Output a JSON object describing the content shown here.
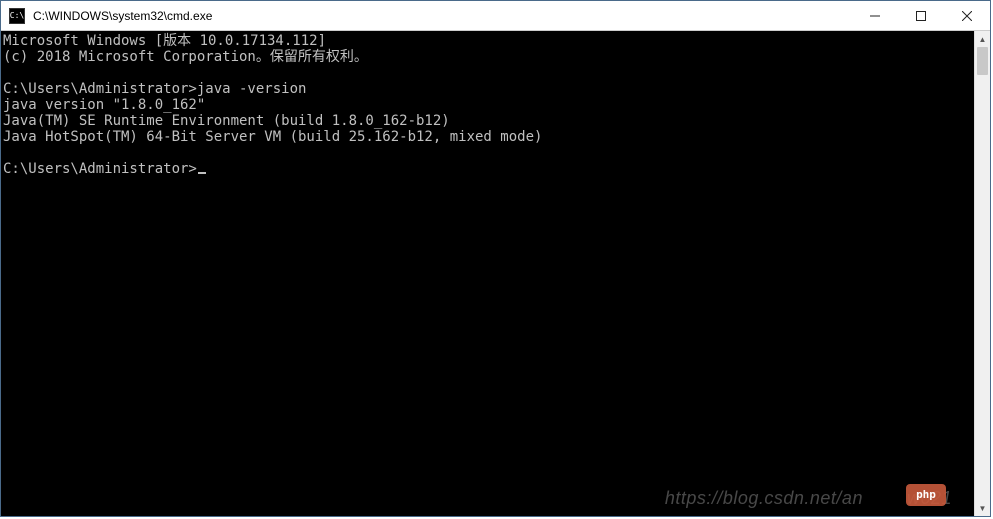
{
  "window": {
    "title": "C:\\WINDOWS\\system32\\cmd.exe",
    "icon_label": "C:\\"
  },
  "terminal": {
    "lines": [
      "Microsoft Windows [版本 10.0.17134.112]",
      "(c) 2018 Microsoft Corporation。保留所有权利。",
      "",
      "C:\\Users\\Administrator>java -version",
      "java version \"1.8.0_162\"",
      "Java(TM) SE Runtime Environment (build 1.8.0_162-b12)",
      "Java HotSpot(TM) 64-Bit Server VM (build 25.162-b12, mixed mode)",
      "",
      "C:\\Users\\Administrator>"
    ],
    "prompt": "C:\\Users\\Administrator>",
    "last_command": "java -version"
  },
  "watermark": {
    "text": "https://blog.csdn.net/an        w021",
    "badge": "php"
  }
}
